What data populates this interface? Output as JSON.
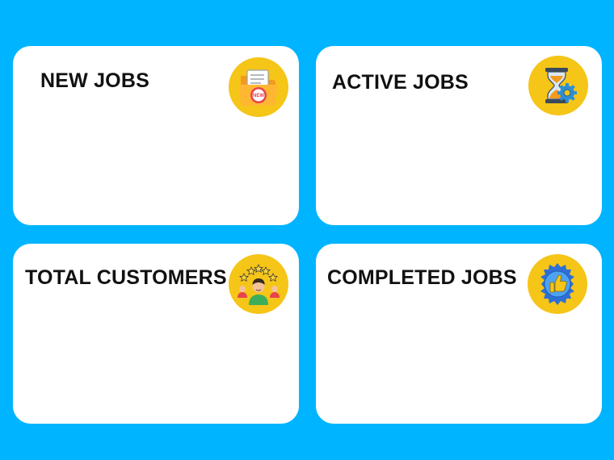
{
  "cards": [
    {
      "title": "NEW JOBS",
      "icon": "new-jobs-folder-icon"
    },
    {
      "title": "ACTIVE JOBS",
      "icon": "hourglass-gear-icon"
    },
    {
      "title": "TOTAL CUSTOMERS",
      "icon": "customer-rating-icon"
    },
    {
      "title": "COMPLETED JOBS",
      "icon": "thumbs-up-badge-icon"
    }
  ],
  "new_jobs_badge_text": "NEW",
  "colors": {
    "background": "#00b4ff",
    "card": "#ffffff",
    "badge": "#f5c518",
    "title_text": "#111111"
  }
}
